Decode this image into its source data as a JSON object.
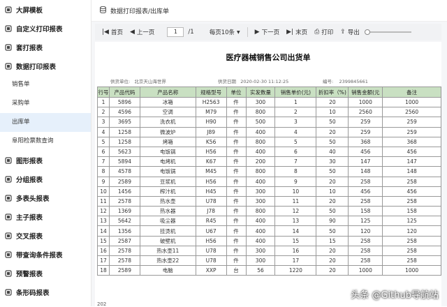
{
  "sidebar": {
    "items": [
      {
        "label": "大屏模板",
        "icon": "monitor-icon"
      },
      {
        "label": "自定义打印报表",
        "icon": "print-icon"
      },
      {
        "label": "套打报表",
        "icon": "stack-icon"
      },
      {
        "label": "数据打印报表",
        "icon": "database-icon"
      }
    ],
    "sub_items": [
      {
        "label": "销售单"
      },
      {
        "label": "采购单"
      },
      {
        "label": "出库单"
      },
      {
        "label": "阜阳检票数查询"
      }
    ],
    "items2": [
      {
        "label": "图形报表",
        "icon": "chart-icon"
      },
      {
        "label": "分组报表",
        "icon": "group-icon"
      },
      {
        "label": "多表头报表",
        "icon": "multi-header-icon"
      },
      {
        "label": "主子报表",
        "icon": "master-detail-icon"
      },
      {
        "label": "交叉报表",
        "icon": "cross-icon"
      },
      {
        "label": "带查询条件报表",
        "icon": "query-icon"
      },
      {
        "label": "预警报表",
        "icon": "warning-icon"
      },
      {
        "label": "条形码报表",
        "icon": "barcode-icon"
      }
    ]
  },
  "breadcrumb": {
    "text": "数据打印报表/出库单"
  },
  "toolbar": {
    "first": "首页",
    "prev": "上一页",
    "page": "1",
    "total": "/1",
    "per_page": "每页10条",
    "next": "下一页",
    "last": "末页",
    "print": "打印",
    "export": "导出"
  },
  "report": {
    "title": "医疗器械销售公司出货单",
    "supplier_label": "供货单位:",
    "supplier": "北京天山海世界",
    "date_label": "供货日期",
    "date": "2020-02-30 11:12:25",
    "no_label": "编号:",
    "no": "2399845661",
    "headers": [
      "行号",
      "产品代码",
      "产品名称",
      "规格型号",
      "单位",
      "实发数量",
      "销售单价(元)",
      "折扣率（%)",
      "销售金额(元",
      "备注"
    ],
    "rows": [
      [
        "1",
        "5896",
        "冰箱",
        "H2563",
        "件",
        "300",
        "1",
        "20",
        "1000",
        "1000"
      ],
      [
        "2",
        "4596",
        "空调",
        "M79",
        "件",
        "800",
        "2",
        "10",
        "2560",
        "2560"
      ],
      [
        "3",
        "3695",
        "洗衣机",
        "H90",
        "件",
        "500",
        "3",
        "50",
        "259",
        "259"
      ],
      [
        "4",
        "1258",
        "微波炉",
        "J89",
        "件",
        "400",
        "4",
        "20",
        "259",
        "259"
      ],
      [
        "5",
        "1258",
        "烤箱",
        "K56",
        "件",
        "800",
        "5",
        "50",
        "368",
        "368"
      ],
      [
        "6",
        "5623",
        "电饭锅",
        "H56",
        "件",
        "400",
        "6",
        "40",
        "456",
        "456"
      ],
      [
        "7",
        "5894",
        "电烤机",
        "K67",
        "件",
        "200",
        "7",
        "30",
        "147",
        "147"
      ],
      [
        "8",
        "4578",
        "电饭锅",
        "M45",
        "件",
        "800",
        "8",
        "50",
        "148",
        "148"
      ],
      [
        "9",
        "2589",
        "豆浆机",
        "H56",
        "件",
        "400",
        "9",
        "20",
        "258",
        "258"
      ],
      [
        "10",
        "1456",
        "榨汁机",
        "H45",
        "件",
        "300",
        "10",
        "10",
        "456",
        "456"
      ],
      [
        "11",
        "2578",
        "热水壶",
        "U78",
        "件",
        "300",
        "11",
        "20",
        "258",
        "258"
      ],
      [
        "12",
        "1369",
        "热水器",
        "J78",
        "件",
        "800",
        "12",
        "50",
        "158",
        "158"
      ],
      [
        "13",
        "5642",
        "吸尘器",
        "R45",
        "件",
        "400",
        "13",
        "90",
        "125",
        "125"
      ],
      [
        "14",
        "1356",
        "挂烫机",
        "U67",
        "件",
        "400",
        "14",
        "50",
        "120",
        "120"
      ],
      [
        "15",
        "2587",
        "破壁机",
        "H56",
        "件",
        "400",
        "15",
        "15",
        "258",
        "258"
      ],
      [
        "16",
        "2578",
        "热水壶11",
        "U78",
        "件",
        "300",
        "16",
        "20",
        "258",
        "258"
      ],
      [
        "17",
        "2578",
        "热水壶22",
        "U78",
        "件",
        "300",
        "17",
        "20",
        "258",
        "258"
      ],
      [
        "18",
        "2589",
        "电脑",
        "XXP",
        "台",
        "56",
        "1220",
        "20",
        "1000",
        "1000"
      ]
    ],
    "footer": "202"
  },
  "watermark": "头条 @Github导航站",
  "colors": {
    "header_bg": "#c9e0c2",
    "active_bg": "#e6f0fb"
  }
}
